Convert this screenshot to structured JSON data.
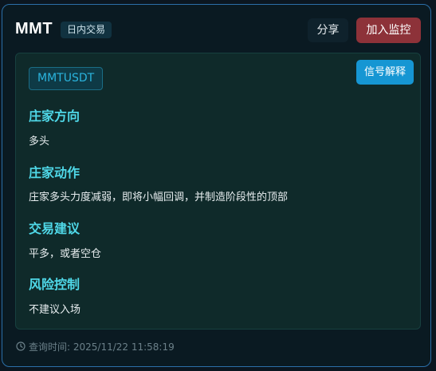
{
  "header": {
    "title": "MMT",
    "badge": "日内交易",
    "share_label": "分享",
    "watch_label": "加入监控"
  },
  "panel": {
    "symbol": "MMTUSDT",
    "explain_label": "信号解释",
    "sections": [
      {
        "title": "庄家方向",
        "text": "多头"
      },
      {
        "title": "庄家动作",
        "text": "庄家多头力度减弱，即将小幅回调，并制造阶段性的顶部"
      },
      {
        "title": "交易建议",
        "text": "平多，或者空仓"
      },
      {
        "title": "风险控制",
        "text": "不建议入场"
      }
    ]
  },
  "footer": {
    "icon": "clock-icon",
    "query_time": "查询时间: 2025/11/22 11:58:19"
  },
  "colors": {
    "border": "#2b6fa8",
    "section_title": "#4fd8e8",
    "watch_button": "#8d3239",
    "explain_button": "#1696d3",
    "symbol_tag_text": "#2ab4de"
  }
}
